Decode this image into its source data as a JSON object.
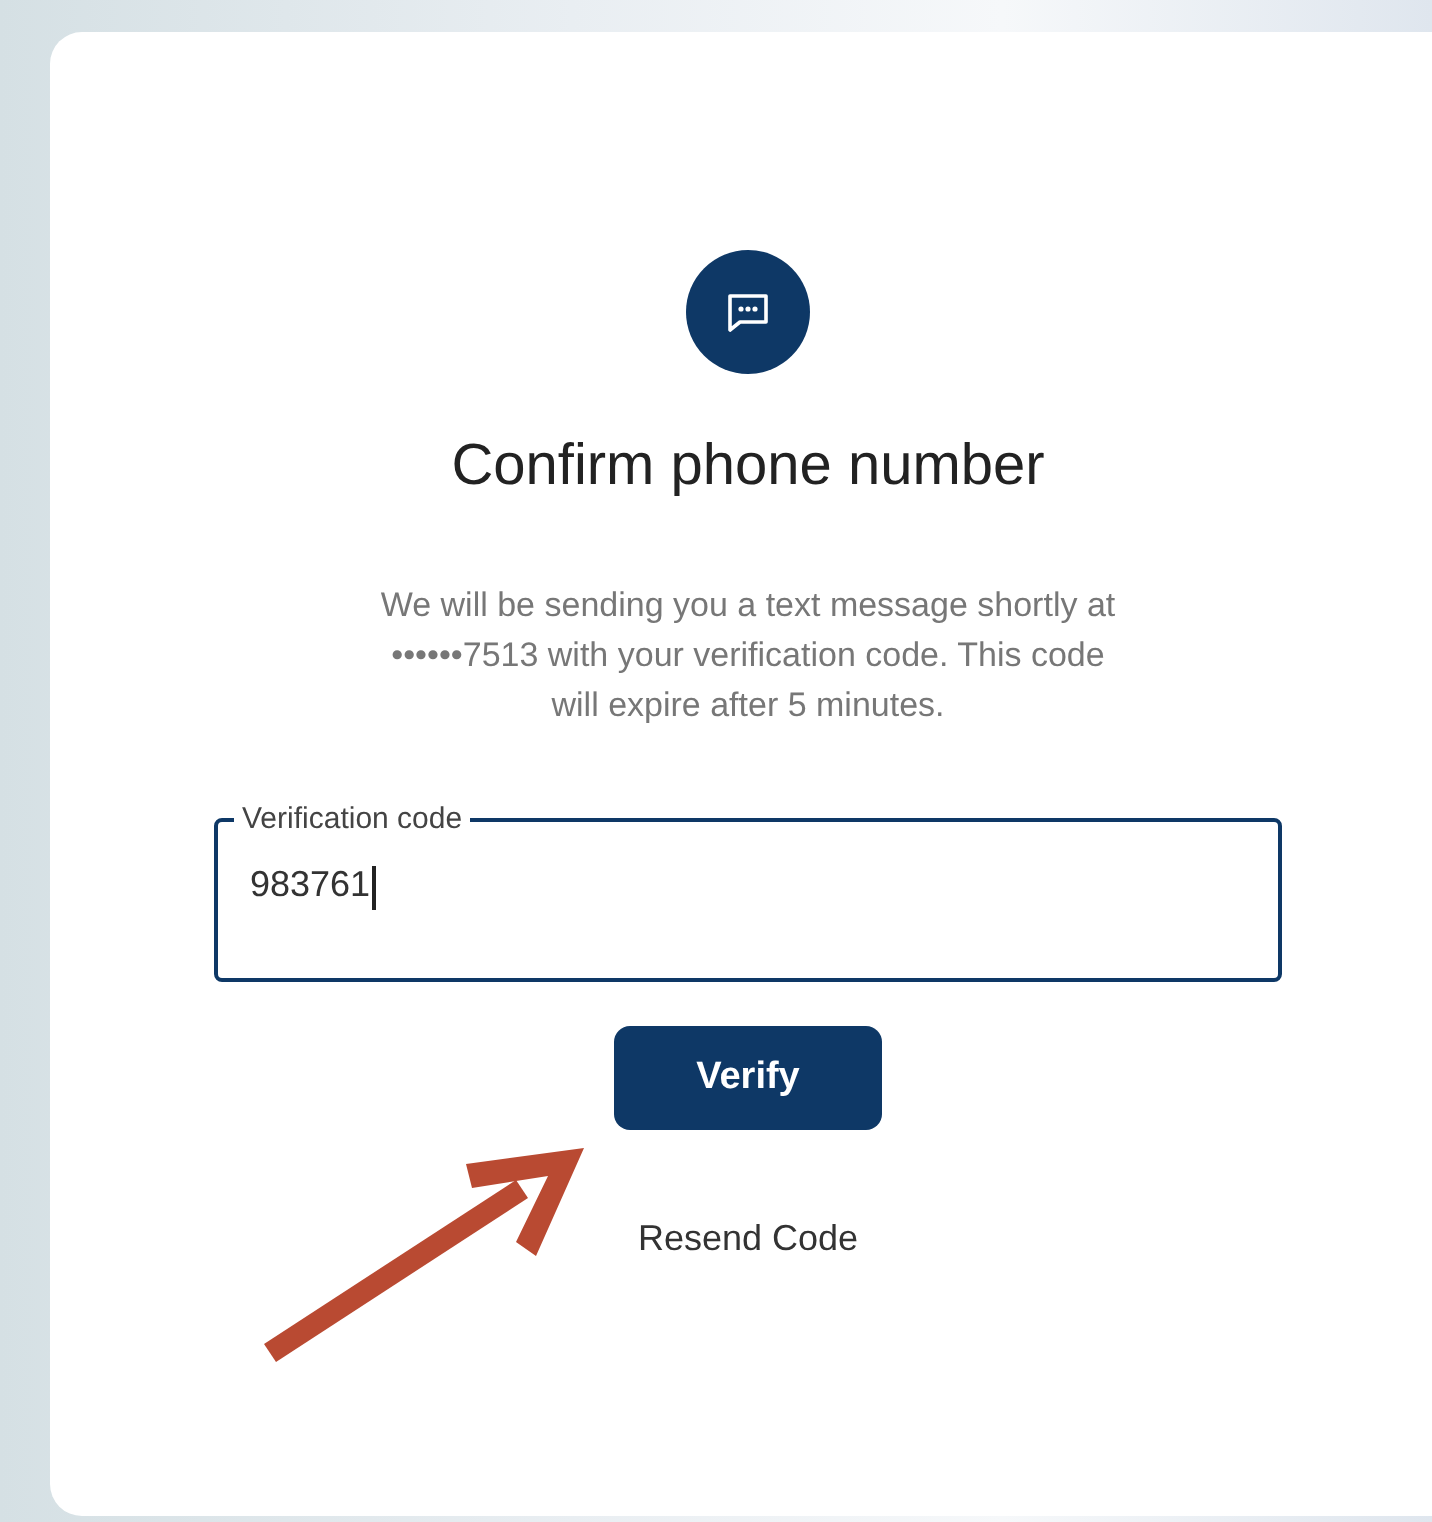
{
  "title": "Confirm phone number",
  "message": "We will be sending you a text message shortly at ••••••7513 with your verification code. This code will expire after 5 minutes.",
  "field": {
    "label": "Verification code",
    "value": "983761",
    "focused": true
  },
  "buttons": [
    {
      "kind": "primary",
      "label": "Verify"
    },
    {
      "kind": "link",
      "label": "Resend Code"
    }
  ]
}
